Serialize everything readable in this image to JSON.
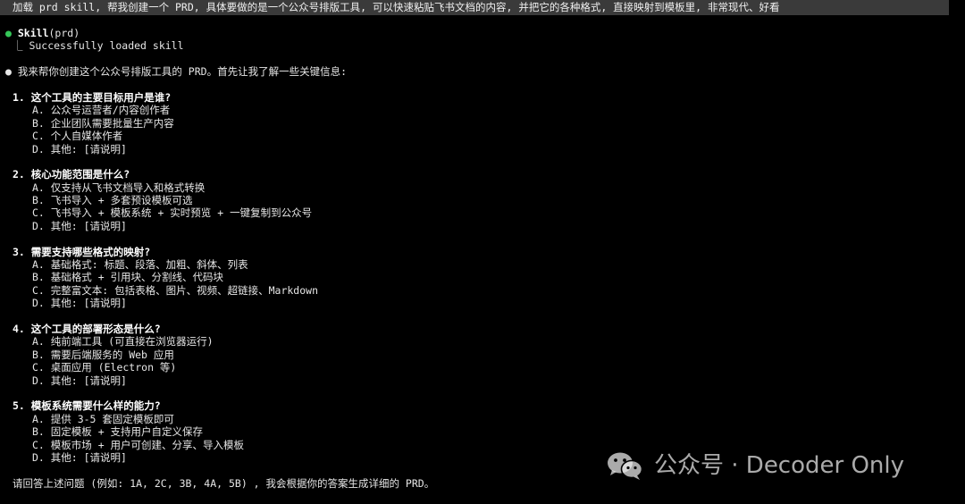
{
  "prompt": "加载 prd skill, 帮我创建一个 PRD, 具体要做的是一个公众号排版工具, 可以快速粘贴飞书文档的内容, 并把它的各种格式, 直接映射到模板里, 非常现代、好看",
  "skill": {
    "bullet": "●",
    "name": "Skill",
    "arg": "(prd)",
    "tree_glyph": "⎿",
    "status": "Successfully loaded skill"
  },
  "intro": {
    "bullet": "●",
    "text": "我来帮你创建这个公众号排版工具的 PRD。首先让我了解一些关键信息:"
  },
  "questions": [
    {
      "title": "1. 这个工具的主要目标用户是谁?",
      "options": [
        "A. 公众号运营者/内容创作者",
        "B. 企业团队需要批量生产内容",
        "C. 个人自媒体作者",
        "D. 其他: [请说明]"
      ]
    },
    {
      "title": "2. 核心功能范围是什么?",
      "options": [
        "A. 仅支持从飞书文档导入和格式转换",
        "B. 飞书导入 + 多套预设模板可选",
        "C. 飞书导入 + 模板系统 + 实时预览 + 一键复制到公众号",
        "D. 其他: [请说明]"
      ]
    },
    {
      "title": "3. 需要支持哪些格式的映射?",
      "options": [
        "A. 基础格式: 标题、段落、加粗、斜体、列表",
        "B. 基础格式 + 引用块、分割线、代码块",
        "C. 完整富文本: 包括表格、图片、视频、超链接、Markdown",
        "D. 其他: [请说明]"
      ]
    },
    {
      "title": "4. 这个工具的部署形态是什么?",
      "options": [
        "A. 纯前端工具 (可直接在浏览器运行)",
        "B. 需要后端服务的 Web 应用",
        "C. 桌面应用 (Electron 等)",
        "D. 其他: [请说明]"
      ]
    },
    {
      "title": "5. 模板系统需要什么样的能力?",
      "options": [
        "A. 提供 3-5 套固定模板即可",
        "B. 固定模板 + 支持用户自定义保存",
        "C. 模板市场 + 用户可创建、分享、导入模板",
        "D. 其他: [请说明]"
      ]
    }
  ],
  "closing": "请回答上述问题 (例如: 1A, 2C, 3B, 4A, 5B) , 我会根据你的答案生成详细的 PRD。",
  "watermark": {
    "icon": "wechat-icon",
    "text": "公众号 · Decoder Only"
  },
  "colors": {
    "background": "#000000",
    "prompt_bg": "#3a3a3a",
    "accent_green": "#35c759",
    "text": "#e6e6e6"
  }
}
